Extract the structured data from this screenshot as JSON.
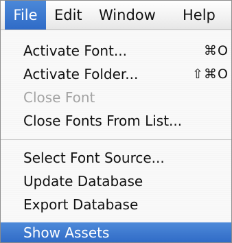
{
  "menubar": {
    "items": [
      "File",
      "Edit",
      "Window",
      "Help"
    ],
    "active": "File"
  },
  "menu": {
    "items": [
      {
        "label": "Activate Font...",
        "shortcut": "⌘O",
        "enabled": true
      },
      {
        "label": "Activate Folder...",
        "shortcut": "⇧⌘O",
        "enabled": true
      },
      {
        "label": "Close Font",
        "shortcut": "",
        "enabled": false
      },
      {
        "label": "Close Fonts From List...",
        "shortcut": "",
        "enabled": true
      },
      {
        "label": "Select Font Source...",
        "shortcut": "",
        "enabled": true
      },
      {
        "label": "Update Database",
        "shortcut": "",
        "enabled": true
      },
      {
        "label": "Export Database",
        "shortcut": "",
        "enabled": true
      },
      {
        "label": "Show Assets",
        "shortcut": "",
        "enabled": true,
        "highlighted": true
      }
    ]
  },
  "colors": {
    "highlight": "#2f6bc7",
    "disabled_text": "#a3a3a3",
    "text": "#111111"
  }
}
